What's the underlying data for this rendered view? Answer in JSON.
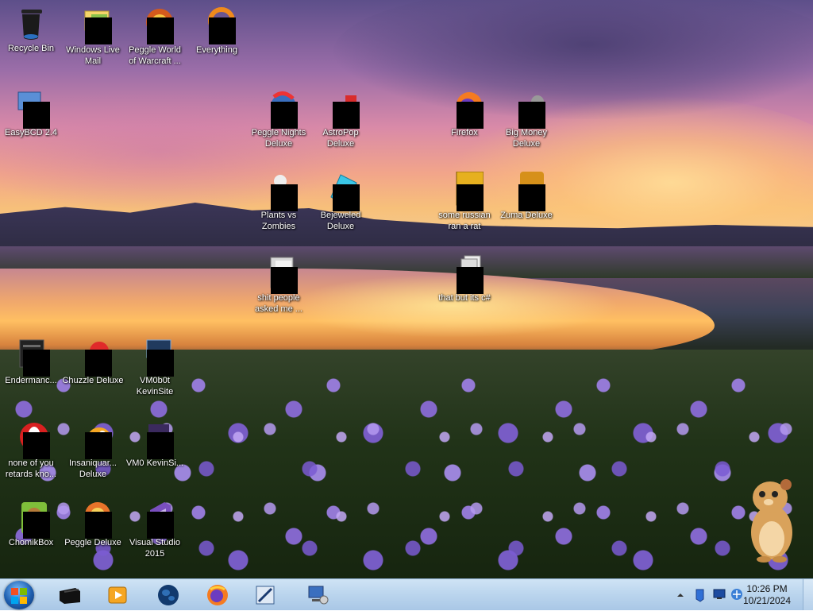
{
  "desktop_icons": {
    "recycle_bin": "Recycle Bin",
    "windows_live_mail": "Windows Live Mail",
    "peggle_world_of_warcraft": "Peggle World of Warcraft ...",
    "everything": "Everything",
    "easybcd": "EasyBCD 2.4",
    "peggle_nights": "Peggle Nights Deluxe",
    "astropop": "AstroPop Deluxe",
    "firefox": "Firefox",
    "big_money": "Big Money Deluxe",
    "plants_vs_zombies": "Plants vs Zombies",
    "bejeweled": "Bejeweled Deluxe",
    "some_russian": "some russian ran a rat",
    "zuma": "Zuma Deluxe",
    "folder_people": "shit people asked me ...",
    "folder_csharp": "that but its c#",
    "endermanc": "Endermanc...",
    "chuzzle": "Chuzzle Deluxe",
    "vm0b0t": "VM0b0t KevinSite",
    "none_of_you": "none of you retards kno...",
    "insaniquarium": "Insaniquar... Deluxe",
    "vm0_kevinsi": "VM0 KevinSi...",
    "chomikbox": "ChomikBox",
    "peggle_deluxe": "Peggle Deluxe",
    "visual_studio": "Visual Studio 2015"
  },
  "taskbar": {
    "pinned": [
      "start-menu",
      "terminal",
      "media-player",
      "globe",
      "firefox",
      "paint-editor",
      "network-tool"
    ],
    "clock": {
      "time": "10:26 PM",
      "date": "10/21/2024"
    },
    "tray_icons": [
      "show-hidden-icons",
      "action-center-icon",
      "display-icon",
      "network-icon"
    ]
  },
  "colors": {
    "taskbar": "#bcd6ee",
    "label_text": "#ffffff"
  }
}
